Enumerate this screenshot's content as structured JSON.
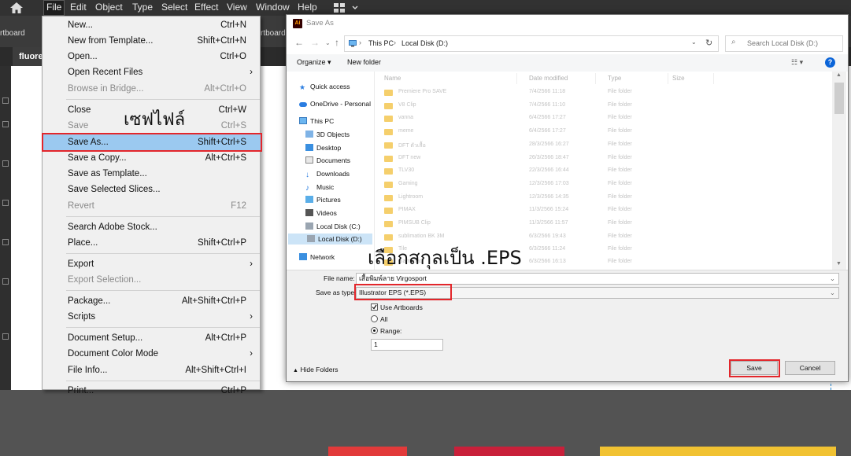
{
  "menubar": {
    "items": [
      "File",
      "Edit",
      "Object",
      "Type",
      "Select",
      "Effect",
      "View",
      "Window",
      "Help"
    ]
  },
  "ctrlbar": {
    "left_text": "rtboard",
    "right_text": "rtboard 1"
  },
  "document_tab": {
    "label": "fluore"
  },
  "file_menu": {
    "items": [
      {
        "label": "New...",
        "shortcut": "Ctrl+N"
      },
      {
        "label": "New from Template...",
        "shortcut": "Shift+Ctrl+N"
      },
      {
        "label": "Open...",
        "shortcut": "Ctrl+O"
      },
      {
        "label": "Open Recent Files",
        "shortcut": ""
      },
      {
        "label": "Browse in Bridge...",
        "shortcut": "Alt+Ctrl+O"
      },
      {
        "label": "Close",
        "shortcut": "Ctrl+W"
      },
      {
        "label": "Save",
        "shortcut": "Ctrl+S"
      },
      {
        "label": "Save As...",
        "shortcut": "Shift+Ctrl+S"
      },
      {
        "label": "Save a Copy...",
        "shortcut": "Alt+Ctrl+S"
      },
      {
        "label": "Save as Template...",
        "shortcut": ""
      },
      {
        "label": "Save Selected Slices...",
        "shortcut": ""
      },
      {
        "label": "Revert",
        "shortcut": "F12"
      },
      {
        "label": "Search Adobe Stock...",
        "shortcut": ""
      },
      {
        "label": "Place...",
        "shortcut": "Shift+Ctrl+P"
      },
      {
        "label": "Export",
        "shortcut": ""
      },
      {
        "label": "Export Selection...",
        "shortcut": ""
      },
      {
        "label": "Package...",
        "shortcut": "Alt+Shift+Ctrl+P"
      },
      {
        "label": "Scripts",
        "shortcut": ""
      },
      {
        "label": "Document Setup...",
        "shortcut": "Alt+Ctrl+P"
      },
      {
        "label": "Document Color Mode",
        "shortcut": ""
      },
      {
        "label": "File Info...",
        "shortcut": "Alt+Shift+Ctrl+I"
      },
      {
        "label": "Print...",
        "shortcut": "Ctrl+P"
      }
    ]
  },
  "annotations": {
    "save_file": "เซฟไฟล์",
    "choose_eps": "เลือกสกุลเป็น .EPS"
  },
  "dialog": {
    "title": "Save As",
    "path": [
      "This PC",
      "Local Disk (D:)"
    ],
    "search_placeholder": "Search Local Disk (D:)",
    "organize": "Organize",
    "new_folder": "New folder",
    "columns": [
      "Name",
      "Date modified",
      "Type",
      "Size"
    ],
    "nav": [
      "Quick access",
      "OneDrive - Personal",
      "This PC",
      "3D Objects",
      "Desktop",
      "Documents",
      "Downloads",
      "Music",
      "Pictures",
      "Videos",
      "Local Disk (C:)",
      "Local Disk (D:)",
      "Network"
    ],
    "files": [
      {
        "name": "Premiere Pro SAVE",
        "date": "7/4/2566 11:18",
        "type": "File folder"
      },
      {
        "name": "V8 Clip",
        "date": "7/4/2566 11:10",
        "type": "File folder"
      },
      {
        "name": "vanna",
        "date": "6/4/2566 17:27",
        "type": "File folder"
      },
      {
        "name": "meme",
        "date": "6/4/2566 17:27",
        "type": "File folder"
      },
      {
        "name": "DFT ตัวเสื้อ",
        "date": "28/3/2566 16:27",
        "type": "File folder"
      },
      {
        "name": "DFT new",
        "date": "26/3/2566 18:47",
        "type": "File folder"
      },
      {
        "name": "TLV30",
        "date": "22/3/2566 16:44",
        "type": "File folder"
      },
      {
        "name": "Gaming",
        "date": "12/3/2566 17:03",
        "type": "File folder"
      },
      {
        "name": "Lightroom",
        "date": "12/3/2566 14:35",
        "type": "File folder"
      },
      {
        "name": "PIMAX",
        "date": "11/3/2566 15:24",
        "type": "File folder"
      },
      {
        "name": "PIMSUB Clip",
        "date": "11/3/2566 11:57",
        "type": "File folder"
      },
      {
        "name": "sublimation BK 3M",
        "date": "6/3/2566 19:43",
        "type": "File folder"
      },
      {
        "name": "Tile",
        "date": "6/3/2566 11:24",
        "type": "File folder"
      },
      {
        "name": "Gamepad",
        "date": "6/3/2566 16:13",
        "type": "File folder"
      }
    ],
    "file_name_label": "File name:",
    "file_name_value": "เสื้อพิมพ์ลาย Virgosport",
    "save_type_label": "Save as type:",
    "save_type_value": "Illustrator EPS (*.EPS)",
    "use_artboards": "Use Artboards",
    "all": "All",
    "range": "Range:",
    "range_value": "1",
    "hide_folders": "Hide Folders",
    "save": "Save",
    "cancel": "Cancel"
  },
  "colors": {
    "highlight_box": "#e3262b",
    "menu_selection": "#9bc9f0",
    "folder": "#f5cf6c"
  }
}
